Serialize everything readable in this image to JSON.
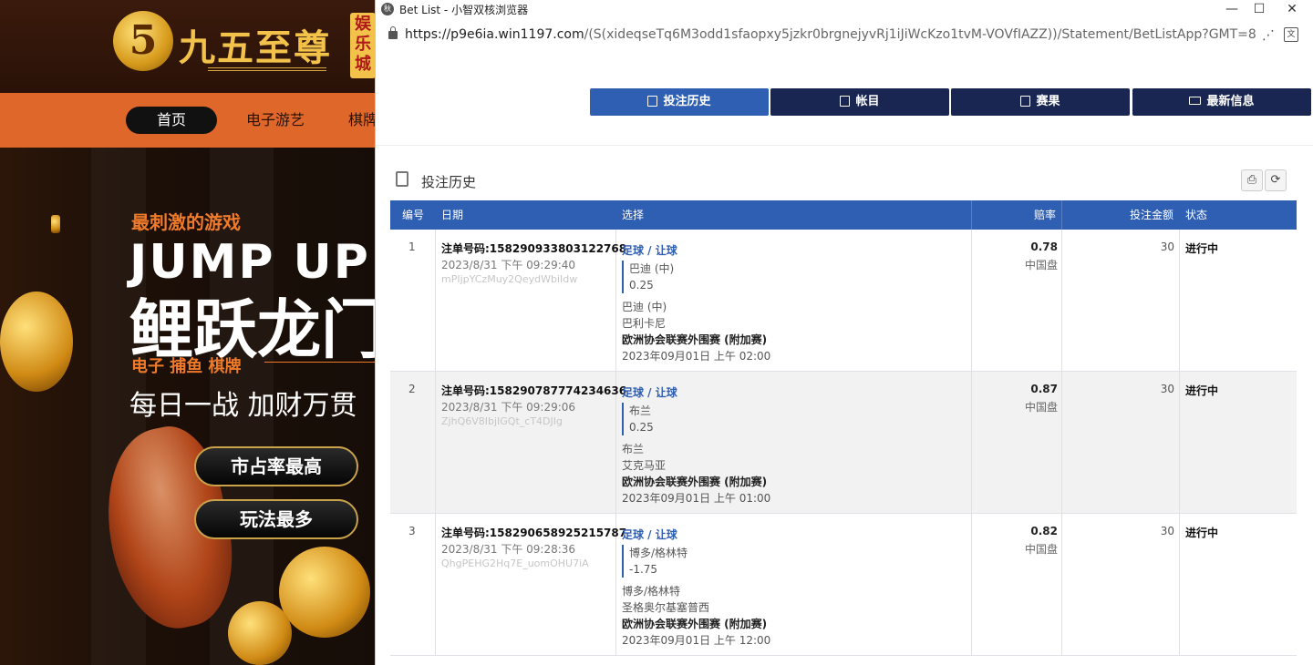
{
  "background": {
    "logo_mark": "5",
    "logo_text": "九五至尊",
    "logo_badge": "娱乐城",
    "nav": [
      "首页",
      "电子游艺",
      "棋牌"
    ],
    "tagline": "最刺激的游戏",
    "headline_en": "JUMP UP",
    "headline_cn": "鲤跃龙门",
    "categories": "电子  捕鱼  棋牌",
    "slogan": "每日一战  加财万贯",
    "pill_1": "市占率最高",
    "pill_2": "玩法最多"
  },
  "window": {
    "app_icon": "秋",
    "title": "Bet List - 小智双核浏览器",
    "btn_min": "—",
    "btn_max": "☐",
    "btn_close": "✕"
  },
  "address": {
    "url_main": "https://p9e6ia.win1197.com",
    "url_path": "/(S(xideqseTq6M3odd1sfaopxy5jzkr0brgnejyvRj1iJiWcKzo1tvM-VOVfIAZZ))/Statement/BetListApp?GMT=8",
    "share_glyph": "⋰",
    "translate_glyph": "文"
  },
  "topnav": {
    "history": "投注历史",
    "account": "帐目",
    "results": "赛果",
    "news": "最新信息"
  },
  "section": {
    "title": "投注历史",
    "print_glyph": "⎙",
    "refresh_glyph": "⟳"
  },
  "table": {
    "headers": {
      "no": "编号",
      "date": "日期",
      "selection": "选择",
      "odds": "赔率",
      "stake": "投注金额",
      "status": "状态"
    },
    "rows": [
      {
        "no": "1",
        "ticket": "注单号码:158290933803122768",
        "time": "2023/8/31 下午 09:29:40",
        "ref": "mPIjpYCzMuy2QeydWbiIdw",
        "sport": "足球 / 让球",
        "pick": "巴迪 (中)",
        "line": "0.25",
        "team1": "巴迪 (中)",
        "team2": "巴利卡尼",
        "league": "欧洲协会联赛外围赛 (附加赛)",
        "match_time": "2023年09月01日 上午 02:00",
        "odds": "0.78",
        "odds_type": "中国盘",
        "stake": "30",
        "status": "进行中"
      },
      {
        "no": "2",
        "ticket": "注单号码:158290787774234636",
        "time": "2023/8/31 下午 09:29:06",
        "ref": "ZjhQ6V8IbjIGQt_cT4DJIg",
        "sport": "足球 / 让球",
        "pick": "布兰",
        "line": "0.25",
        "team1": "布兰",
        "team2": "艾克马亚",
        "league": "欧洲协会联赛外围赛 (附加赛)",
        "match_time": "2023年09月01日 上午 01:00",
        "odds": "0.87",
        "odds_type": "中国盘",
        "stake": "30",
        "status": "进行中"
      },
      {
        "no": "3",
        "ticket": "注单号码:158290658925215787",
        "time": "2023/8/31 下午 09:28:36",
        "ref": "QhgPEHG2Hq7E_uomOHU7iA",
        "sport": "足球 / 让球",
        "pick": "博多/格林特",
        "line": "-1.75",
        "team1": "博多/格林特",
        "team2": "圣格奥尔基塞普西",
        "league": "欧洲协会联赛外围赛 (附加赛)",
        "match_time": "2023年09月01日 上午 12:00",
        "odds": "0.82",
        "odds_type": "中国盘",
        "stake": "30",
        "status": "进行中"
      }
    ]
  },
  "colors": {
    "primary_blue": "#2f5fb3",
    "navy": "#182651",
    "site_orange": "#e0672a"
  }
}
